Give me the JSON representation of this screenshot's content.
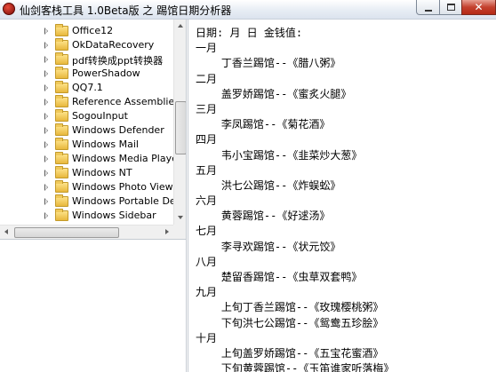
{
  "window": {
    "title": "仙剑客栈工具 1.0Beta版 之 踢馆日期分析器",
    "icon": "app-red-orb-icon",
    "buttons": {
      "minimize": "minimize-icon",
      "maximize": "maximize-icon",
      "close": "close-icon"
    }
  },
  "tree": {
    "items": [
      {
        "label": "Office12",
        "icon": "folder-icon"
      },
      {
        "label": "OkDataRecovery",
        "icon": "folder-icon"
      },
      {
        "label": "pdf转换成ppt转换器",
        "icon": "folder-icon"
      },
      {
        "label": "PowerShadow",
        "icon": "folder-icon"
      },
      {
        "label": "QQ7.1",
        "icon": "folder-icon"
      },
      {
        "label": "Reference Assemblies",
        "icon": "folder-icon"
      },
      {
        "label": "SogouInput",
        "icon": "folder-icon"
      },
      {
        "label": "Windows Defender",
        "icon": "folder-icon"
      },
      {
        "label": "Windows Mail",
        "icon": "folder-icon"
      },
      {
        "label": "Windows Media Player",
        "icon": "folder-icon"
      },
      {
        "label": "Windows NT",
        "icon": "folder-icon"
      },
      {
        "label": "Windows Photo Viewer",
        "icon": "folder-icon"
      },
      {
        "label": "Windows Portable Devic",
        "icon": "folder-icon"
      },
      {
        "label": "Windows Sidebar",
        "icon": "folder-icon"
      }
    ]
  },
  "results": {
    "header": "日期: 月 日 金钱值:",
    "lines": [
      "一月",
      "    丁香兰踢馆--《腊八粥》",
      "二月",
      "    盖罗娇踢馆--《蜜炙火腿》",
      "三月",
      "    李凤踢馆--《菊花酒》",
      "四月",
      "    韦小宝踢馆--《韭菜炒大葱》",
      "五月",
      "    洪七公踢馆--《炸蜈蚣》",
      "六月",
      "    黄蓉踢馆--《好逑汤》",
      "七月",
      "    李寻欢踢馆--《状元饺》",
      "八月",
      "    楚留香踢馆--《虫草双套鸭》",
      "九月",
      "    上旬丁香兰踢馆--《玫瑰樱桃粥》",
      "    下旬洪七公踢馆--《鸳鸯五珍脍》",
      "十月",
      "    上旬盖罗娇踢馆--《五宝花蜜酒》",
      "    下旬黄蓉踢馆--《玉笛谁家听落梅》"
    ]
  }
}
